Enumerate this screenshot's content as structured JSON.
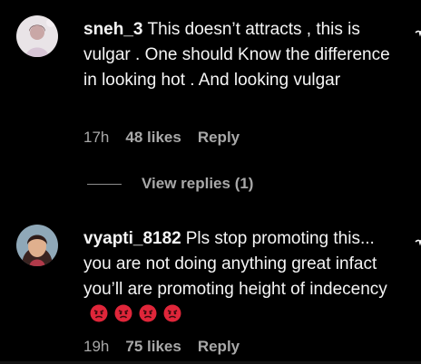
{
  "comments": [
    {
      "username": "sneh_3",
      "text": "This doesn’t attracts , this is vulgar . One should Know the difference in looking hot . And looking vulgar",
      "time": "17h",
      "likes": "48 likes",
      "reply_label": "Reply",
      "icon": "heart-outline-icon"
    },
    {
      "username": "vyapti_8182",
      "text": "Pls stop promoting this... you are not doing anything great infact you’ll are promoting height of indecency",
      "emojis": [
        "angry-face",
        "angry-face",
        "angry-face",
        "angry-face"
      ],
      "time": "19h",
      "likes": "75 likes",
      "reply_label": "Reply",
      "icon": "heart-outline-icon"
    }
  ],
  "view_replies": "View replies (1)",
  "colors": {
    "background": "#000000",
    "text": "#f5f5f5",
    "secondary": "#a8a8a8",
    "emoji": "#e0263a"
  }
}
